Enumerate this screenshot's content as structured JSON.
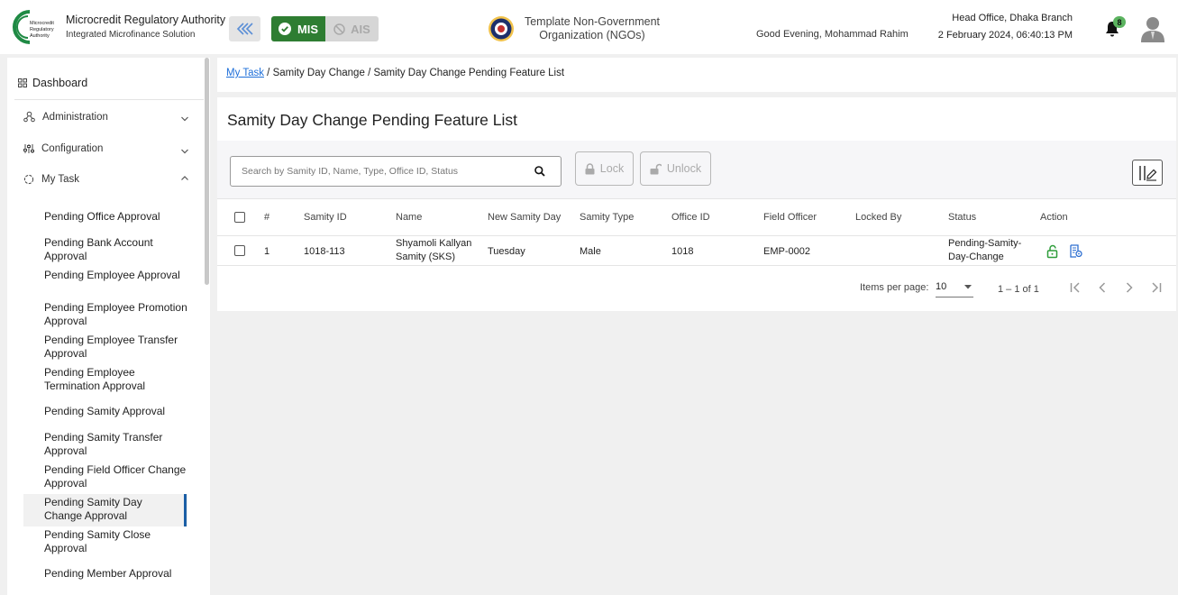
{
  "header": {
    "brand_title": "Microcredit Regulatory Authority",
    "brand_subtitle": "Integrated Microfinance Solution",
    "logo_text": [
      "Microcredit",
      "Regulatory",
      "Authority"
    ],
    "mis_label": "MIS",
    "ais_label": "AIS",
    "org_name": "Template Non-Government Organization (NGOs)",
    "greeting": "Good Evening, Mohammad Rahim",
    "branch": "Head Office, Dhaka Branch",
    "datetime": "2 February 2024, 06:40:13 PM",
    "notification_count": "8",
    "colors": {
      "mis": "#2e7d32",
      "accent": "#1b5fa6",
      "badge": "#5bb35f"
    }
  },
  "sidebar": {
    "dashboard": "Dashboard",
    "sections": [
      {
        "label": "Administration",
        "icon": "admin-icon",
        "expanded": false
      },
      {
        "label": "Configuration",
        "icon": "sliders-icon",
        "expanded": false
      },
      {
        "label": "My Task",
        "icon": "task-icon",
        "expanded": true
      }
    ],
    "items": [
      "Pending Office Approval",
      "Pending Bank Account Approval",
      "Pending Employee Approval",
      "Pending Employee Promotion Approval",
      "Pending Employee Transfer Approval",
      "Pending Employee Termination Approval",
      "Pending Samity Approval",
      "Pending Samity Transfer Approval",
      "Pending Field Officer Change Approval",
      "Pending Samity Day Change Approval",
      "Pending Samity Close Approval",
      "Pending Member Approval"
    ],
    "active_item": "Pending Samity Day Change Approval"
  },
  "breadcrumb": {
    "link": "My Task",
    "middle": "Samity Day Change",
    "current": "Samity Day Change Pending Feature List",
    "separator": "/"
  },
  "main": {
    "title": "Samity Day Change Pending Feature List",
    "search_placeholder": "Search by Samity ID, Name, Type, Office ID, Status",
    "lock_label": "Lock",
    "unlock_label": "Unlock"
  },
  "table": {
    "columns": [
      "#",
      "Samity ID",
      "Name",
      "New Samity Day",
      "Samity Type",
      "Office ID",
      "Field Officer",
      "Locked By",
      "Status",
      "Action"
    ],
    "rows": [
      {
        "index": "1",
        "samity_id": "1018-113",
        "name": "Shyamoli Kallyan Samity (SKS)",
        "new_day": "Tuesday",
        "type": "Male",
        "office_id": "1018",
        "field_officer": "EMP-0002",
        "locked_by": "",
        "status": "Pending-Samity-Day-Change",
        "actions": [
          "unlock-icon",
          "details-icon"
        ]
      }
    ]
  },
  "pagination": {
    "label": "Items per page:",
    "page_size": "10",
    "range": "1 – 1 of 1"
  }
}
